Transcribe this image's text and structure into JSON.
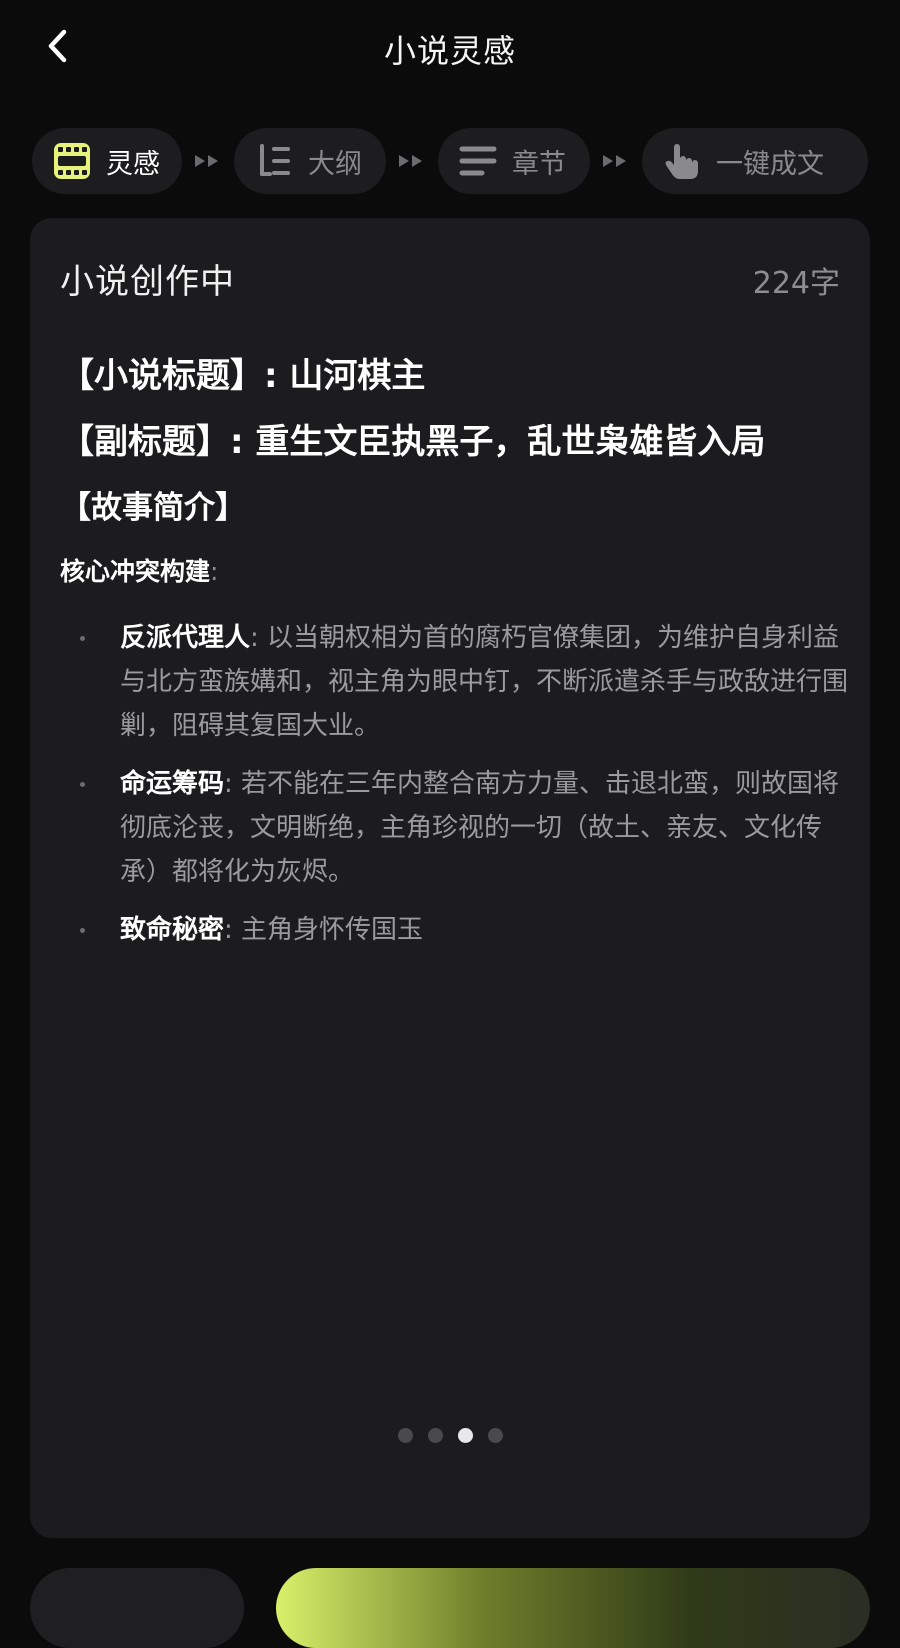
{
  "header": {
    "title": "小说灵感"
  },
  "steps": [
    {
      "label": "灵感",
      "icon": "film-strip-icon",
      "active": true
    },
    {
      "label": "大纲",
      "icon": "outline-tree-icon",
      "active": false
    },
    {
      "label": "章节",
      "icon": "lines-icon",
      "active": false
    },
    {
      "label": "一键成文",
      "icon": "hand-tap-icon",
      "active": false
    }
  ],
  "card": {
    "title": "小说创作中",
    "word_count": "224字",
    "novel_title_line": "【小说标题】: 山河棋主",
    "subtitle_line": "【副标题】: 重生文臣执黑子，乱世枭雄皆入局",
    "synopsis_heading": "【故事简介】",
    "core_conflict_label": "核心冲突构建",
    "core_conflict_colon": ":",
    "bullets": [
      {
        "title": "反派代理人",
        "colon": ": ",
        "text": "以当朝权相为首的腐朽官僚集团，为维护自身利益与北方蛮族媾和，视主角为眼中钉，不断派遣杀手与政敌进行围剿，阻碍其复国大业。"
      },
      {
        "title": "命运筹码",
        "colon": ": ",
        "text": "若不能在三年内整合南方力量、击退北蛮，则故国将彻底沦丧，文明断绝，主角珍视的一切（故土、亲友、文化传承）都将化为灰烬。"
      },
      {
        "title": "致命秘密",
        "colon": ": ",
        "text": "主角身怀传国玉"
      }
    ]
  },
  "pager": {
    "count": 4,
    "active_index": 2
  },
  "colors": {
    "accent": "#e6f27a",
    "background": "#0b0b0c",
    "card": "#1c1c1e"
  }
}
